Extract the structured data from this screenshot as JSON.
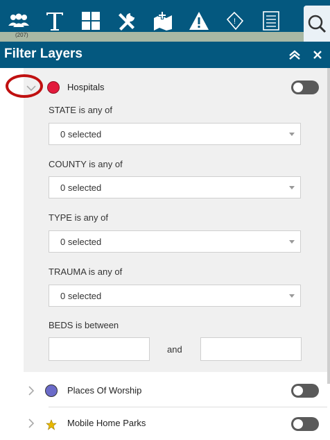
{
  "panel": {
    "title": "Filter Layers"
  },
  "map": {
    "route_label": "(207)"
  },
  "layers": [
    {
      "name": "Hospitals",
      "color": "#e21a3c",
      "expanded": true,
      "enabled": false,
      "filters": [
        {
          "label": "STATE is any of",
          "value": "0 selected"
        },
        {
          "label": "COUNTY is any of",
          "value": "0 selected"
        },
        {
          "label": "TYPE is any of",
          "value": "0 selected"
        },
        {
          "label": "TRAUMA is any of",
          "value": "0 selected"
        }
      ],
      "range_filter": {
        "label": "BEDS is between",
        "joiner": "and"
      }
    },
    {
      "name": "Places Of Worship",
      "color": "#6b6bc9",
      "expanded": false,
      "enabled": false
    },
    {
      "name": "Mobile Home Parks",
      "color": "#e8b800",
      "expanded": false,
      "enabled": false
    }
  ],
  "toolbar": {
    "icons": [
      "people-icon",
      "text-icon",
      "grid-icon",
      "tools-icon",
      "add-layer-icon",
      "warning-icon",
      "poi-icon",
      "list-icon",
      "search-icon"
    ]
  },
  "colors": {
    "header": "#04587f",
    "highlight": "#c01010"
  }
}
